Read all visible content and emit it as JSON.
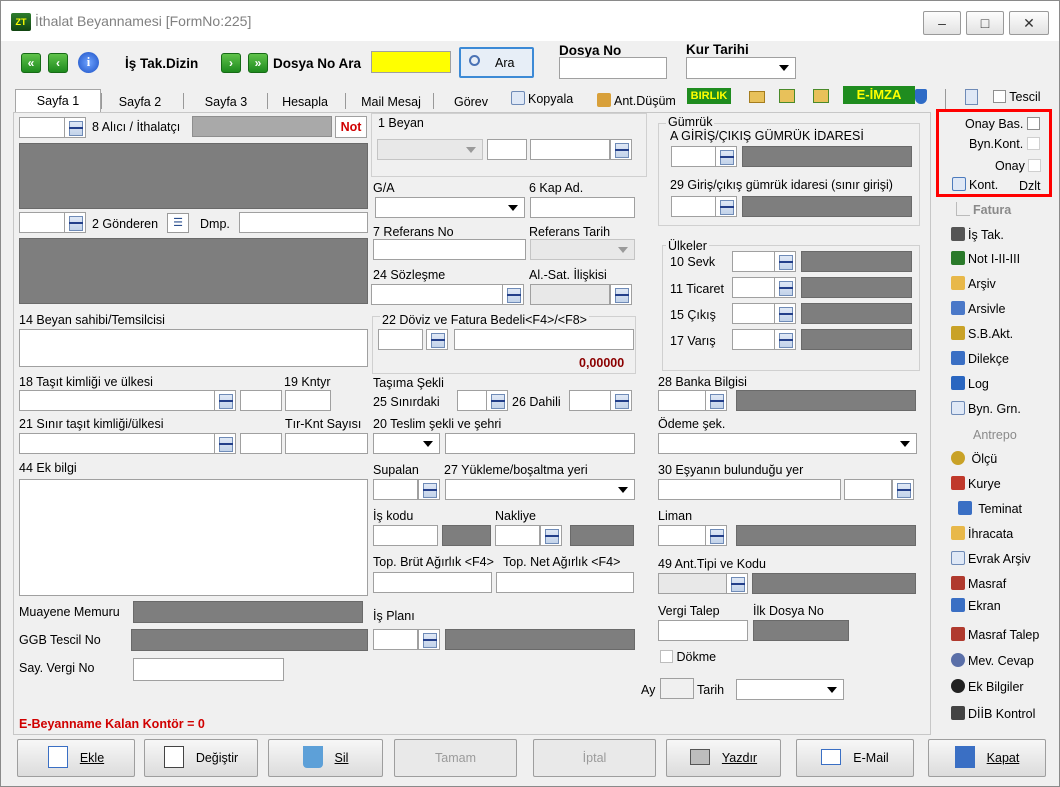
{
  "window": {
    "title": "İthalat Beyannamesi [FormNo:225]",
    "minimize": "–",
    "maximize": "□",
    "close": "✕"
  },
  "toolbar": {
    "is_tak_dizin": "İş Tak.Dizin",
    "dosya_no_ara": "Dosya No Ara",
    "ara_button": "Ara",
    "dosya_no_label": "Dosya No",
    "kur_tarihi_label": "Kur Tarihi",
    "first": "«",
    "prev": "‹",
    "next": "›",
    "last": "»"
  },
  "tabs": [
    "Sayfa 1",
    "Sayfa 2",
    "Sayfa 3",
    "Hesapla",
    "Mail Mesaj",
    "Görev"
  ],
  "tab_actions": {
    "kopyala": "Kopyala",
    "ant_dusum": "Ant.Düşüm",
    "birlik": "BIRLIK",
    "eimza": "E-İMZA",
    "tescil": "Tescil"
  },
  "form": {
    "alici": "8 Alıcı / İthalatçı",
    "not": "Not",
    "gonderen": "2 Gönderen",
    "dmp": "Dmp.",
    "beyan_sahibi": "14 Beyan sahibi/Temsilcisi",
    "tasit": "18 Taşıt kimliği ve ülkesi",
    "kntyr": "19 Kntyr",
    "sinir_tasit": "21 Sınır taşıt kimliği/ülkesi",
    "tir_knt": "Tır-Knt Sayısı",
    "ek_bilgi": "44 Ek bilgi",
    "muayene": "Muayene Memuru",
    "ggb_tescil": "GGB Tescil No",
    "say_vergi": "Say. Vergi No",
    "kontor": "E-Beyanname Kalan Kontör = 0",
    "beyan": "1 Beyan",
    "ga": "G/A",
    "kap_ad": "6 Kap Ad.",
    "ref_no": "7 Referans No",
    "ref_tarih": "Referans Tarih",
    "sozlesme": "24 Sözleşme",
    "al_sat": "Al.-Sat. İlişkisi",
    "doviz": "22 Döviz ve Fatura Bedeli<F4>/<F8>",
    "doviz_value": "0,00000",
    "tasima": "Taşıma Şekli",
    "sinirdaki": "25 Sınırdaki",
    "dahili": "26 Dahili",
    "teslim": "20 Teslim şekli ve şehri",
    "supalan": "Supalan",
    "yukleme": "27 Yükleme/boşaltma yeri",
    "is_kodu": "İş kodu",
    "nakliye": "Nakliye",
    "top_brut": "Top. Brüt Ağırlık <F4>",
    "top_net": "Top. Net Ağırlık <F4>",
    "is_plani": "İş Planı",
    "gumruk": "Gümrük",
    "giris_cikis": "A GİRİŞ/ÇIKIŞ GÜMRÜK İDARESİ",
    "sinir_girisi": "29 Giriş/çıkış gümrük idaresi (sınır girişi)",
    "ulkeler": "Ülkeler",
    "sevk": "10 Sevk",
    "ticaret": "11 Ticaret",
    "cikis": "15 Çıkış",
    "varis": "17 Varış",
    "banka": "28 Banka Bilgisi",
    "odeme": "Ödeme şek.",
    "esya_yer": "30 Eşyanın bulunduğu yer",
    "liman": "Liman",
    "ant_tipi": "49 Ant.Tipi ve Kodu",
    "vergi_talep": "Vergi Talep",
    "ilk_dosya": "İlk Dosya No",
    "dokme": "Dökme",
    "ay": "Ay",
    "tarih": "Tarih"
  },
  "sidebar": {
    "onay_bas": "Onay Bas.",
    "byn_kont": "Byn.Kont.",
    "onay": "Onay",
    "kont": "Kont.",
    "dzlt": "Dzlt",
    "items": [
      "Fatura",
      "İş Tak.",
      "Not I-II-III",
      "Arşiv",
      "Arsivle",
      "S.B.Akt.",
      "Dilekçe",
      "Log",
      "Byn. Grn.",
      "Antrepo",
      "Ölçü",
      "Kurye",
      "Teminat",
      "İhracata",
      "Evrak Arşiv",
      "Masraf",
      "Ekran",
      "Masraf Talep",
      "Mev. Cevap",
      "Ek Bilgiler",
      "DİİB Kontrol"
    ]
  },
  "buttons": {
    "ekle": "Ekle",
    "degistir": "Değiştir",
    "sil": "Sil",
    "tamam": "Tamam",
    "iptal": "İptal",
    "yazdir": "Yazdır",
    "email": "E-Mail",
    "kapat": "Kapat"
  },
  "colors": {
    "accent_red": "#d00000",
    "highlight_yellow": "#ffff00",
    "field_grey": "#7e7e7e"
  }
}
